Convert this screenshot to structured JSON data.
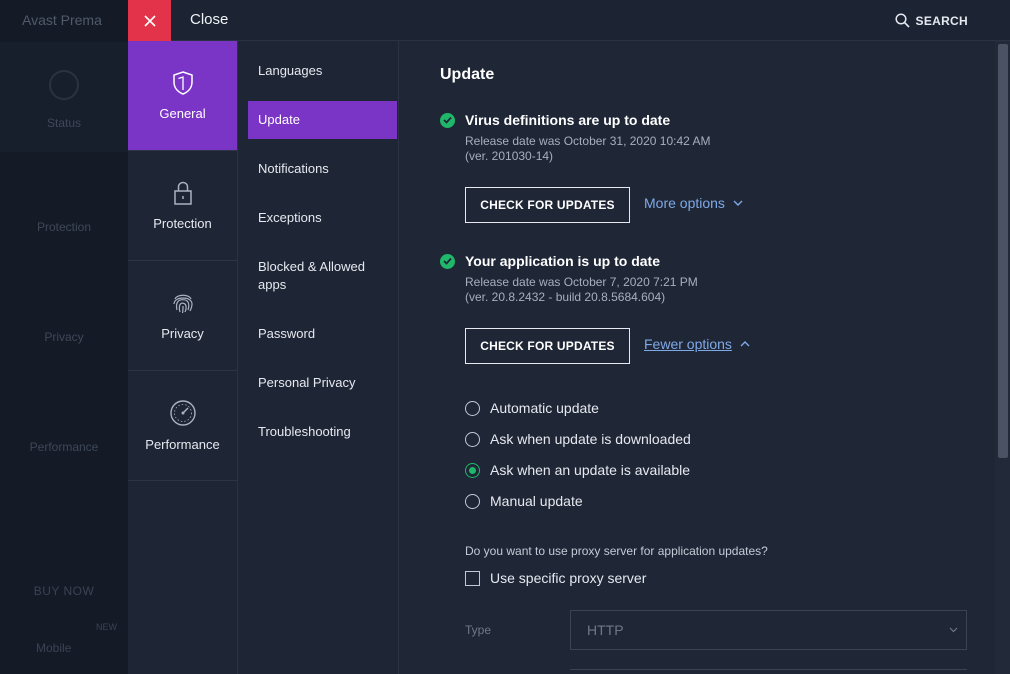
{
  "background_app": {
    "title": "Avast Prema",
    "nav": [
      "Status",
      "Protection",
      "Privacy",
      "Performance"
    ],
    "buy_now": "BUY NOW",
    "new_badge": "NEW",
    "mobile": "Mobile"
  },
  "topbar": {
    "close_label": "Close",
    "search_label": "SEARCH"
  },
  "categories": [
    {
      "label": "General",
      "icon": "shield-icon",
      "active": true
    },
    {
      "label": "Protection",
      "icon": "lock-icon",
      "active": false
    },
    {
      "label": "Privacy",
      "icon": "fingerprint-icon",
      "active": false
    },
    {
      "label": "Performance",
      "icon": "speedometer-icon",
      "active": false
    }
  ],
  "submenu": [
    {
      "label": "Languages",
      "active": false
    },
    {
      "label": "Update",
      "active": true
    },
    {
      "label": "Notifications",
      "active": false
    },
    {
      "label": "Exceptions",
      "active": false
    },
    {
      "label": "Blocked & Allowed apps",
      "active": false
    },
    {
      "label": "Password",
      "active": false
    },
    {
      "label": "Personal Privacy",
      "active": false
    },
    {
      "label": "Troubleshooting",
      "active": false
    }
  ],
  "main": {
    "title": "Update",
    "virus": {
      "title": "Virus definitions are up to date",
      "release": "Release date was October 31, 2020 10:42 AM",
      "version": "(ver. 201030-14)",
      "button": "CHECK FOR UPDATES",
      "options_link": "More options"
    },
    "app": {
      "title": "Your application is up to date",
      "release": "Release date was October 7, 2020 7:21 PM",
      "version": "(ver. 20.8.2432 - build 20.8.5684.604)",
      "button": "CHECK FOR UPDATES",
      "options_link": "Fewer options"
    },
    "radio_options": [
      {
        "label": "Automatic update",
        "selected": false
      },
      {
        "label": "Ask when update is downloaded",
        "selected": false
      },
      {
        "label": "Ask when an update is available",
        "selected": true
      },
      {
        "label": "Manual update",
        "selected": false
      }
    ],
    "proxy_question": "Do you want to use proxy server for application updates?",
    "proxy_checkbox": "Use specific proxy server",
    "type_label": "Type",
    "type_value": "HTTP"
  },
  "colors": {
    "accent_purple": "#7b35c6",
    "close_red": "#e3334a",
    "success_green": "#1fb86a",
    "link_blue": "#7fa9e6"
  }
}
